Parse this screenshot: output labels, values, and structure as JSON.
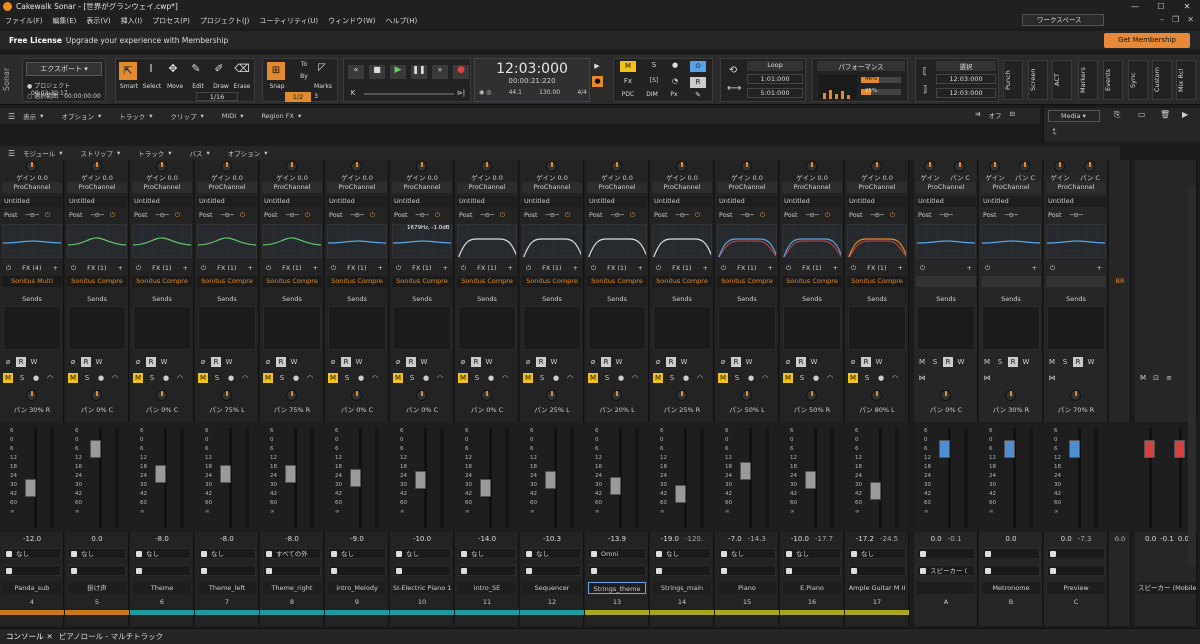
{
  "titlebar": {
    "title": "Cakewalk Sonar - [世界がグランウェイ.cwp*]",
    "min": "—",
    "max": "☐",
    "close": "✕"
  },
  "menu": [
    "ファイル(F)",
    "編集(E)",
    "表示(V)",
    "挿入(I)",
    "プロセス(P)",
    "プロジェクト(J)",
    "ユーティリティ(U)",
    "ウィンドウ(W)",
    "ヘルプ(H)"
  ],
  "workspace": "ワークスペース",
  "license": {
    "title": "Free License",
    "message": "Upgrade your experience with Membership",
    "button": "Get Membership"
  },
  "sidebar_label": "Sonar",
  "export": {
    "label": "エクスポート",
    "project_label": "プロジェクト",
    "project_time": "00:03:30:17",
    "range_label": "選択範囲",
    "range_time": "00:00:00:00"
  },
  "tools": {
    "smart": "Smart",
    "select": "Select",
    "move": "Move",
    "edit": "Edit",
    "draw": "Draw",
    "erase": "Erase",
    "draw_val": "1/16"
  },
  "snap": {
    "label": "Snap",
    "val": "1/2",
    "to": "To",
    "by": "By",
    "marks": "Marks",
    "marks_val": "3"
  },
  "lcd": {
    "time": "12:03:000",
    "sub": "00:00:21:220",
    "t1": "44.1",
    "t2": "16",
    "tempo": "130.00",
    "meter": "4/4"
  },
  "mixbtns": {
    "m": "M",
    "s": "S",
    "r": "R",
    "fx": "Fx",
    "sb": "[S]",
    "pdc": "PDC",
    "dim": "DIM",
    "px": "Px"
  },
  "loop": {
    "label": "Loop",
    "start": "1:01:000",
    "end": "5:01:000"
  },
  "perf": {
    "label": "パフォーマンス",
    "v1": "46%",
    "v2": "25%"
  },
  "sel": {
    "label": "選択",
    "start": "12:03:000",
    "end": "12:03:000"
  },
  "rightlabels": [
    "Punch",
    "Screen",
    "ACT",
    "Markers",
    "Events",
    "Sync",
    "Custom",
    "Mix Rcl"
  ],
  "tb2": [
    "表示",
    "オプション",
    "トラック",
    "クリップ",
    "MIDI",
    "Region FX"
  ],
  "tb2_xoff": "オフ",
  "media": {
    "tab": "Media"
  },
  "tb3": [
    "モジュール",
    "ストリップ",
    "トラック",
    "バス",
    "オプション"
  ],
  "strips": [
    {
      "gain": "ゲイン 0.0",
      "preset": "Untitled",
      "fx": "FX (4)",
      "plugin": "Sonitus Multi",
      "pan": "パン 30% R",
      "vol": "-12.0",
      "vol2": "",
      "in": "なし",
      "out": "",
      "name": "Panda_sub",
      "num": "4",
      "color": "#c8781c",
      "cap": 0.62,
      "eq": "flat"
    },
    {
      "gain": "ゲイン 0.0",
      "preset": "Untitled",
      "fx": "FX (1)",
      "plugin": "Sonitus Compre",
      "pan": "パン 0% C",
      "vol": "0.0",
      "vol2": "",
      "in": "なし",
      "out": "",
      "name": "掛け声",
      "num": "5",
      "color": "#c8781c",
      "cap": 0.15,
      "eq": "bump"
    },
    {
      "gain": "ゲイン 0.0",
      "preset": "Untitled",
      "fx": "FX (1)",
      "plugin": "Sonitus Compre",
      "pan": "パン 0% C",
      "vol": "-8.0",
      "vol2": "",
      "in": "なし",
      "out": "",
      "name": "Theme",
      "num": "6",
      "color": "#1e9aa0",
      "cap": 0.45,
      "eq": "bump"
    },
    {
      "gain": "ゲイン 0.0",
      "preset": "Untitled",
      "fx": "FX (1)",
      "plugin": "Sonitus Compre",
      "pan": "パン 75% L",
      "vol": "-8.0",
      "vol2": "",
      "in": "なし",
      "out": "",
      "name": "Theme_left",
      "num": "7",
      "color": "#1e9aa0",
      "cap": 0.45,
      "eq": "bump"
    },
    {
      "gain": "ゲイン 0.0",
      "preset": "Untitled",
      "fx": "FX (1)",
      "plugin": "Sonitus Compre",
      "pan": "パン 75% R",
      "vol": "-8.0",
      "vol2": "",
      "in": "すべての外",
      "out": "",
      "name": "Theme_right",
      "num": "8",
      "color": "#1e9aa0",
      "cap": 0.45,
      "eq": "bump"
    },
    {
      "gain": "ゲイン 0.0",
      "preset": "Untitled",
      "fx": "FX (1)",
      "plugin": "Sonitus Compre",
      "pan": "パン 0% C",
      "vol": "-9.0",
      "vol2": "",
      "in": "なし",
      "out": "",
      "name": "intro_Melody",
      "num": "9",
      "color": "#1e9aa0",
      "cap": 0.5,
      "eq": "flat"
    },
    {
      "gain": "ゲイン 0.0",
      "preset": "Untitled",
      "fx": "FX (1)",
      "plugin": "Sonitus Compre",
      "pan": "パン 0% C",
      "vol": "-10.0",
      "vol2": "",
      "in": "なし",
      "out": "",
      "name": "SI-Electric Piano 1",
      "num": "10",
      "color": "#1e9aa0",
      "cap": 0.52,
      "eq": "flat",
      "eqlabel": "1679Hz, -1.0dB"
    },
    {
      "gain": "ゲイン 0.0",
      "preset": "Untitled",
      "fx": "FX (1)",
      "plugin": "Sonitus Compre",
      "pan": "パン 0% C",
      "vol": "-14.0",
      "vol2": "",
      "in": "なし",
      "out": "",
      "name": "intro_SE",
      "num": "11",
      "color": "#1e9aa0",
      "cap": 0.62,
      "eq": "hp"
    },
    {
      "gain": "ゲイン 0.0",
      "preset": "Untitled",
      "fx": "FX (1)",
      "plugin": "Sonitus Compre",
      "pan": "パン 25% L",
      "vol": "-10.3",
      "vol2": "",
      "in": "なし",
      "out": "",
      "name": "Sequencer",
      "num": "12",
      "color": "#1e9aa0",
      "cap": 0.53,
      "eq": "hp"
    },
    {
      "gain": "ゲイン 0.0",
      "preset": "Untitled",
      "fx": "FX (1)",
      "plugin": "Sonitus Compre",
      "pan": "パン 20% L",
      "vol": "-13.9",
      "vol2": "",
      "in": "Omni",
      "out": "",
      "name": "Strings_theme",
      "num": "13",
      "color": "#a8a820",
      "cap": 0.6,
      "eq": "hp",
      "selected": true
    },
    {
      "gain": "ゲイン 0.0",
      "preset": "Untitled",
      "fx": "FX (1)",
      "plugin": "Sonitus Compre",
      "pan": "パン 25% R",
      "vol": "-19.0",
      "vol2": "-120.",
      "in": "なし",
      "out": "",
      "name": "Strings_main",
      "num": "14",
      "color": "#a8a820",
      "cap": 0.7,
      "eq": "hp"
    },
    {
      "gain": "ゲイン 0.0",
      "preset": "Untitled",
      "fx": "FX (1)",
      "plugin": "Sonitus Compre",
      "pan": "パン 50% L",
      "vol": "-7.0",
      "vol2": "-14.3",
      "in": "なし",
      "out": "",
      "name": "Piano",
      "num": "15",
      "color": "#a8a820",
      "cap": 0.42,
      "eq": "hpblue"
    },
    {
      "gain": "ゲイン 0.0",
      "preset": "Untitled",
      "fx": "FX (1)",
      "plugin": "Sonitus Compre",
      "pan": "パン 50% R",
      "vol": "-10.0",
      "vol2": "-17.7",
      "in": "なし",
      "out": "",
      "name": "E.Piano",
      "num": "16",
      "color": "#a8a820",
      "cap": 0.52,
      "eq": "hpblue"
    },
    {
      "gain": "ゲイン 0.0",
      "preset": "Untitled",
      "fx": "FX (1)",
      "plugin": "Sonitus Compre",
      "pan": "パン 80% L",
      "vol": "-17.2",
      "vol2": "-24.5",
      "in": "なし",
      "out": "",
      "name": "Ample Guitar M II",
      "num": "17",
      "color": "#a8a820",
      "cap": 0.66,
      "eq": "hporange"
    }
  ],
  "buses": [
    {
      "gain": "ゲイン",
      "pan_top": "パン C",
      "pan": "パン 0% C",
      "vol": "0.0",
      "vol2": "-0.1",
      "out": "スピーカー (",
      "name": "",
      "num": "A",
      "cap": 0.15
    },
    {
      "gain": "ゲイン",
      "pan_top": "パン C",
      "pan": "パン 30% R",
      "vol": "0.0",
      "vol2": "",
      "out": "",
      "name": "Metronome",
      "num": "B",
      "cap": 0.15
    },
    {
      "gain": "ゲイン",
      "pan_top": "パン C",
      "pan": "パン 70% R",
      "vol": "0.0",
      "vol2": "-7.3",
      "out": "",
      "name": "Preview",
      "num": "C",
      "cap": 0.15
    }
  ],
  "partial": {
    "plugin": "BR",
    "vol": "0.0",
    "vol2": "-0.1",
    "vol3": "0.0"
  },
  "master": {
    "name": "スピーカー (MobileP",
    "vol": "0.0",
    "vol2": "-0.1",
    "vol3": "0.0"
  },
  "common": {
    "prochannel": "ProChannel",
    "post": "Post",
    "sends": "Sends",
    "none": "なし"
  },
  "bottom": {
    "console": "コンソール",
    "close": "✕",
    "tab2": "ピアノロール - マルチトラック"
  }
}
